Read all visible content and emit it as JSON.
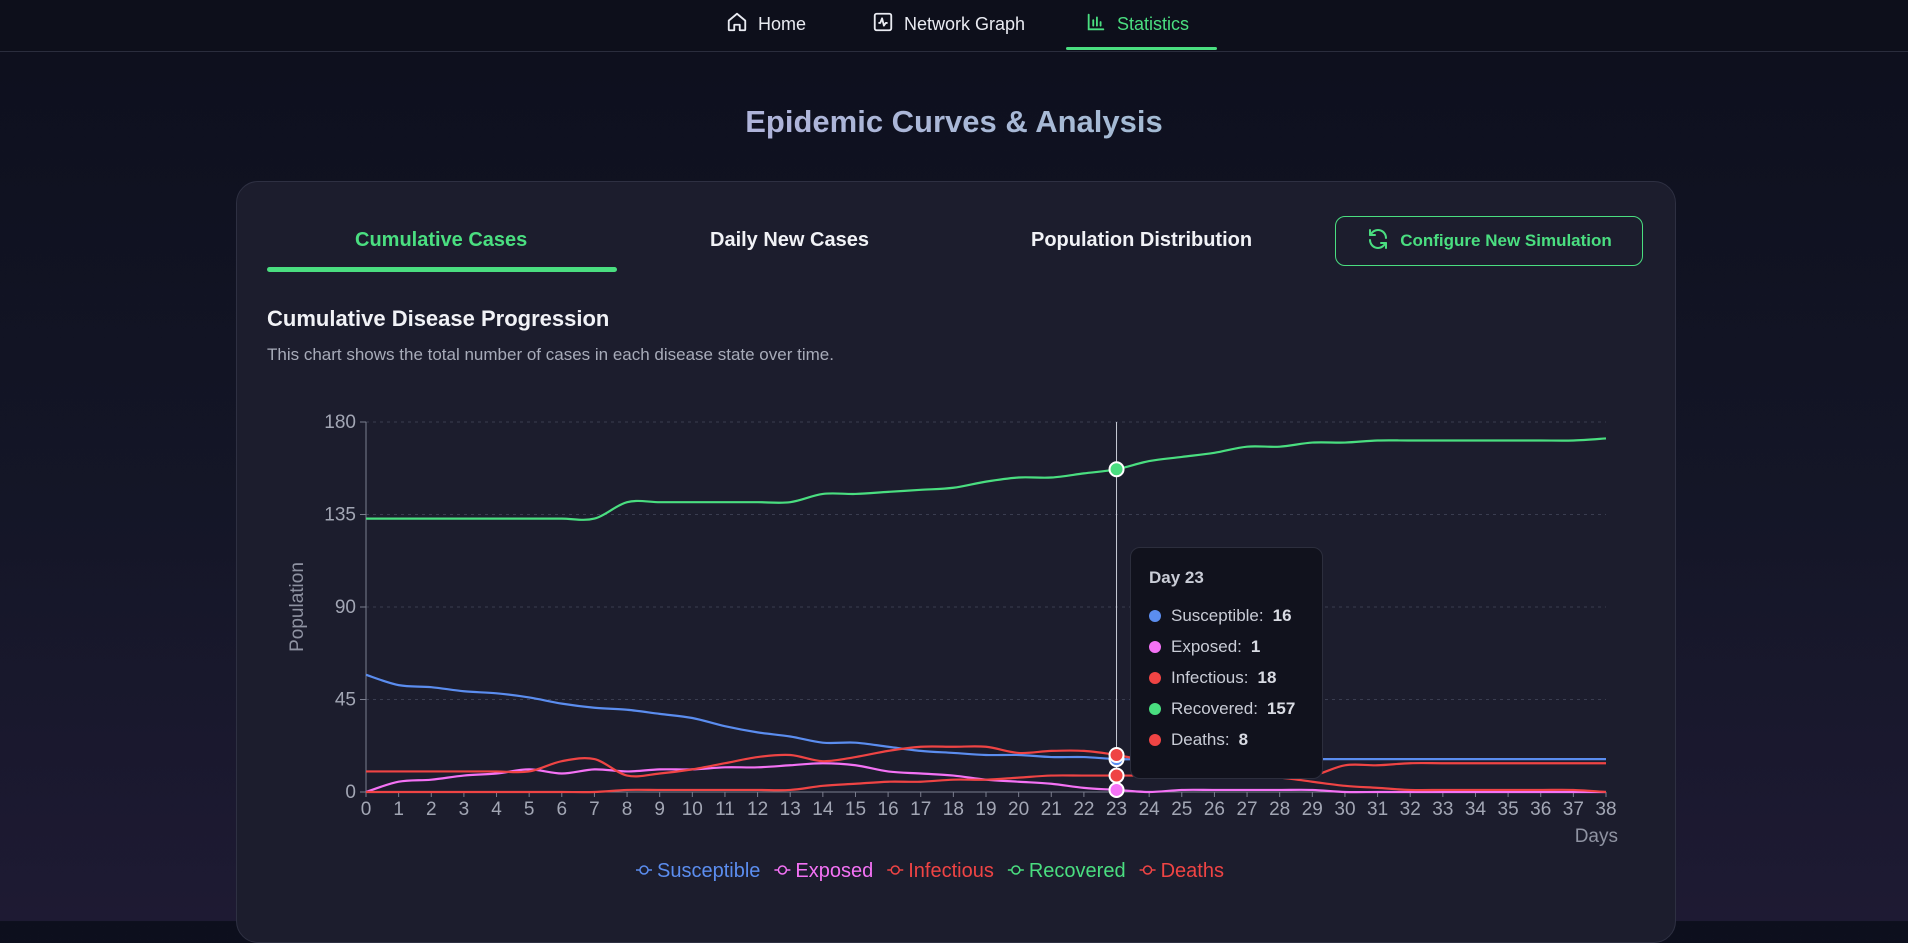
{
  "nav": {
    "items": [
      {
        "label": "Home",
        "icon": "home-icon"
      },
      {
        "label": "Network Graph",
        "icon": "activity-icon"
      },
      {
        "label": "Statistics",
        "icon": "bar-chart-icon",
        "active": true
      }
    ]
  },
  "page_title": "Epidemic Curves & Analysis",
  "tabs": [
    {
      "label": "Cumulative Cases",
      "active": true
    },
    {
      "label": "Daily New Cases"
    },
    {
      "label": "Population Distribution"
    }
  ],
  "config_button": {
    "label": "Configure New Simulation",
    "icon": "refresh-icon"
  },
  "section": {
    "title": "Cumulative Disease Progression",
    "description": "This chart shows the total number of cases in each disease state over time."
  },
  "colors": {
    "accent": "#4ade80",
    "susceptible": "#5b8def",
    "exposed": "#f472f5",
    "infectious": "#ef4444",
    "recovered": "#4ade80",
    "deaths": "#ef4444"
  },
  "chart_data": {
    "type": "line",
    "xlabel": "Days",
    "ylabel": "Population",
    "ylim": [
      0,
      180
    ],
    "yticks": [
      0,
      45,
      90,
      135,
      180
    ],
    "x": [
      0,
      1,
      2,
      3,
      4,
      5,
      6,
      7,
      8,
      9,
      10,
      11,
      12,
      13,
      14,
      15,
      16,
      17,
      18,
      19,
      20,
      21,
      22,
      23,
      24,
      25,
      26,
      27,
      28,
      29,
      30,
      31,
      32,
      33,
      34,
      35,
      36,
      37,
      38
    ],
    "grid": true,
    "legend_position": "bottom",
    "series": [
      {
        "name": "Susceptible",
        "values": [
          57,
          52,
          51,
          49,
          48,
          46,
          43,
          41,
          40,
          38,
          36,
          32,
          29,
          27,
          24,
          24,
          22,
          20,
          19,
          18,
          18,
          17,
          17,
          16,
          16,
          16,
          16,
          16,
          16,
          16,
          16,
          16,
          16,
          16,
          16,
          16,
          16,
          16,
          16
        ]
      },
      {
        "name": "Exposed",
        "values": [
          0,
          5,
          6,
          8,
          9,
          11,
          9,
          11,
          10,
          11,
          11,
          12,
          12,
          13,
          14,
          13,
          10,
          9,
          8,
          6,
          5,
          4,
          2,
          1,
          0,
          1,
          1,
          1,
          1,
          1,
          0,
          0,
          0,
          0,
          0,
          0,
          0,
          0,
          0
        ]
      },
      {
        "name": "Infectious",
        "values": [
          10,
          10,
          10,
          10,
          10,
          10,
          15,
          16,
          8,
          9,
          11,
          14,
          17,
          18,
          15,
          17,
          20,
          22,
          22,
          22,
          19,
          20,
          20,
          18,
          15,
          13,
          12,
          10,
          8,
          8,
          13,
          13,
          14,
          14,
          14,
          14,
          14,
          14,
          14
        ]
      },
      {
        "name": "Recovered",
        "values": [
          133,
          133,
          133,
          133,
          133,
          133,
          133,
          133,
          141,
          141,
          141,
          141,
          141,
          141,
          145,
          145,
          146,
          147,
          148,
          151,
          153,
          153,
          155,
          157,
          161,
          163,
          165,
          168,
          168,
          170,
          170,
          171,
          171,
          171,
          171,
          171,
          171,
          171,
          172
        ]
      },
      {
        "name": "Deaths",
        "values": [
          0,
          0,
          0,
          0,
          0,
          0,
          0,
          0,
          1,
          1,
          1,
          1,
          1,
          1,
          3,
          4,
          5,
          5,
          6,
          6,
          7,
          8,
          8,
          8,
          8,
          8,
          8,
          7,
          7,
          5,
          3,
          2,
          1,
          1,
          1,
          1,
          1,
          1,
          0
        ]
      }
    ],
    "hover": {
      "day_label": "Day 23",
      "rows": [
        {
          "label": "Susceptible:",
          "value": "16"
        },
        {
          "label": "Exposed:",
          "value": "1"
        },
        {
          "label": "Infectious:",
          "value": "18"
        },
        {
          "label": "Recovered:",
          "value": "157"
        },
        {
          "label": "Deaths:",
          "value": "8"
        }
      ]
    }
  }
}
